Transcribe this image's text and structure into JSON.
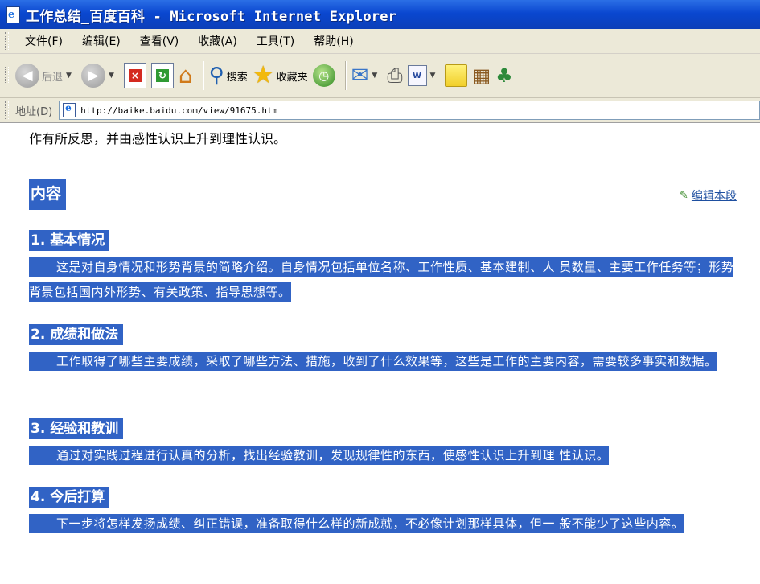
{
  "window": {
    "title": "工作总结_百度百科 - Microsoft Internet Explorer"
  },
  "menu": [
    "文件(F)",
    "编辑(E)",
    "查看(V)",
    "收藏(A)",
    "工具(T)",
    "帮助(H)"
  ],
  "toolbar": {
    "back_label": "后退",
    "search_label": "搜索",
    "favorites_label": "收藏夹"
  },
  "address": {
    "label": "地址(D)",
    "url": "http://baike.baidu.com/view/91675.htm"
  },
  "content": {
    "intro": "作有所反思，并由感性认识上升到理性认识。",
    "heading": "内容",
    "edit_link": "编辑本段",
    "sections": [
      {
        "title": "1. 基本情况",
        "body": "这是对自身情况和形势背景的简略介绍。自身情况包括单位名称、工作性质、基本建制、人 员数量、主要工作任务等；形势背景包括国内外形势、有关政策、指导思想等。"
      },
      {
        "title": "2. 成绩和做法",
        "body": "工作取得了哪些主要成绩，采取了哪些方法、措施，收到了什么效果等，这些是工作的主要内容，需要较多事实和数据。"
      },
      {
        "title": "3. 经验和教训",
        "body": "通过对实践过程进行认真的分析，找出经验教训，发现规律性的东西，使感性认识上升到理 性认识。"
      },
      {
        "title": "4. 今后打算",
        "body": "下一步将怎样发扬成绩、纠正错误，准备取得什么样的新成就，不必像计划那样具体，但一 般不能少了这些内容。"
      }
    ]
  }
}
